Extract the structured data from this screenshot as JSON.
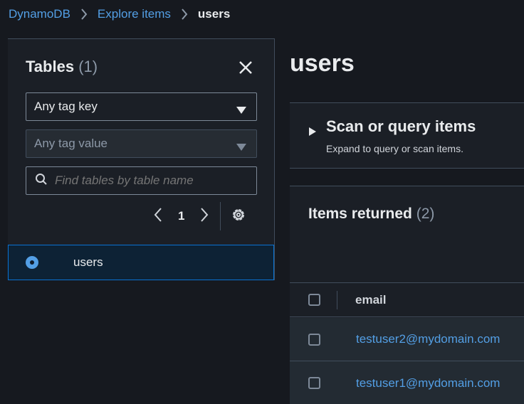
{
  "breadcrumb": {
    "items": [
      "DynamoDB",
      "Explore items"
    ],
    "current": "users"
  },
  "tables_panel": {
    "title": "Tables",
    "count": "(1)",
    "tag_key_select": "Any tag key",
    "tag_value_select": "Any tag value",
    "search_placeholder": "Find tables by table name",
    "page": "1",
    "tables": [
      {
        "name": "users",
        "selected": true
      }
    ]
  },
  "main": {
    "title": "users",
    "scan": {
      "title": "Scan or query items",
      "description": "Expand to query or scan items."
    },
    "items": {
      "title": "Items returned",
      "count": "(2)",
      "columns": [
        "email"
      ],
      "rows": [
        {
          "email": "testuser2@mydomain.com"
        },
        {
          "email": "testuser1@mydomain.com"
        }
      ]
    }
  },
  "colors": {
    "accent": "#539fe5",
    "background": "#16191f",
    "panel": "#1b1f26",
    "border": "#414d5c"
  }
}
